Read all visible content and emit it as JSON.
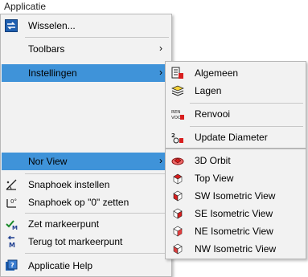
{
  "menubar": {
    "title": "Applicatie"
  },
  "main_menu": {
    "items": [
      {
        "label": "Wisselen...",
        "icon": "swap-arrows-icon"
      },
      {
        "label": "Toolbars",
        "has_submenu": true
      },
      {
        "label": "Instellingen",
        "has_submenu": true,
        "highlighted": true
      },
      {
        "label": "Nor View",
        "has_submenu": true,
        "highlighted": true
      },
      {
        "label": "Snaphoek instellen",
        "icon": "snap-angle-icon"
      },
      {
        "label": "Snaphoek op \"0\" zetten",
        "icon": "snap-angle-zero-icon"
      },
      {
        "label": "Zet markeerpunt",
        "icon": "set-marker-icon"
      },
      {
        "label": "Terug tot markeerpunt",
        "icon": "return-marker-icon"
      },
      {
        "label": "Applicatie Help",
        "icon": "help-icon"
      }
    ],
    "submenu_arrow": "›"
  },
  "instellingen_submenu": {
    "items": [
      {
        "label": "Algemeen",
        "icon": "general-settings-icon"
      },
      {
        "label": "Lagen",
        "icon": "layers-icon"
      },
      {
        "label": "Renvooi",
        "icon": "renvooi-icon",
        "icon_text": "REN\nVOO"
      },
      {
        "label": "Update Diameter",
        "icon": "update-diameter-icon"
      }
    ]
  },
  "norview_submenu": {
    "items": [
      {
        "label": "3D Orbit",
        "icon": "3d-orbit-icon"
      },
      {
        "label": "Top View",
        "icon": "top-view-icon"
      },
      {
        "label": "SW Isometric View",
        "icon": "sw-isometric-icon"
      },
      {
        "label": "SE Isometric View",
        "icon": "se-isometric-icon"
      },
      {
        "label": "NE Isometric View",
        "icon": "ne-isometric-icon"
      },
      {
        "label": "NW Isometric View",
        "icon": "nw-isometric-icon"
      }
    ]
  },
  "colors": {
    "highlight": "#3f93d9",
    "menu_bg": "#f2f2f2",
    "accent_red": "#d81e1e"
  }
}
